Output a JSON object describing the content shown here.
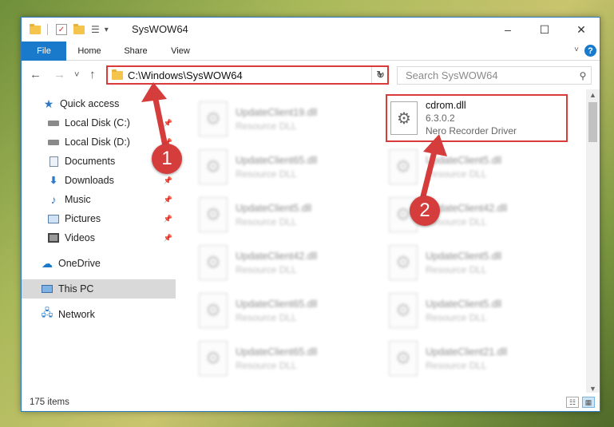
{
  "window": {
    "title": "SysWOW64",
    "controls": {
      "minimize": "–",
      "maximize": "☐",
      "close": "✕"
    }
  },
  "ribbon": {
    "tabs": [
      {
        "label": "File"
      },
      {
        "label": "Home"
      },
      {
        "label": "Share"
      },
      {
        "label": "View"
      }
    ],
    "help": "?"
  },
  "navigation": {
    "back": "←",
    "forward": "→",
    "recent": "˅",
    "up": "↑",
    "address": "C:\\Windows\\SysWOW64",
    "refresh": "↻",
    "search_placeholder": "Search SysWOW64"
  },
  "sidebar": {
    "items": [
      {
        "label": "Quick access",
        "icon": "star-icon",
        "pinned": false
      },
      {
        "label": "Local Disk (C:)",
        "icon": "drive-icon",
        "pinned": true
      },
      {
        "label": "Local Disk (D:)",
        "icon": "drive-icon",
        "pinned": true
      },
      {
        "label": "Documents",
        "icon": "documents-icon",
        "pinned": true
      },
      {
        "label": "Downloads",
        "icon": "downloads-icon",
        "pinned": true
      },
      {
        "label": "Music",
        "icon": "music-icon",
        "pinned": true
      },
      {
        "label": "Pictures",
        "icon": "pictures-icon",
        "pinned": true
      },
      {
        "label": "Videos",
        "icon": "videos-icon",
        "pinned": true
      },
      {
        "label": "OneDrive",
        "icon": "cloud-icon",
        "pinned": false
      },
      {
        "label": "This PC",
        "icon": "computer-icon",
        "pinned": false,
        "selected": true
      },
      {
        "label": "Network",
        "icon": "network-icon",
        "pinned": false
      }
    ]
  },
  "files": {
    "highlighted": {
      "name": "cdrom.dll",
      "version": "6.3.0.2",
      "description": "Nero Recorder Driver"
    },
    "left_column": [
      {
        "name": "UpdateClient19.dll",
        "type": "Resource DLL"
      },
      {
        "name": "UpdateClient65.dll",
        "type": "Resource DLL"
      },
      {
        "name": "UpdateClient5.dll",
        "type": "Resource DLL"
      },
      {
        "name": "UpdateClient42.dll",
        "type": "Resource DLL"
      },
      {
        "name": "UpdateClient65.dll",
        "type": "Resource DLL"
      },
      {
        "name": "UpdateClient65.dll",
        "type": "Resource DLL"
      }
    ],
    "right_column": [
      {
        "name": "UpdateClient5.dll",
        "type": "Resource DLL"
      },
      {
        "name": "UpdateClient42.dll",
        "type": "Resource DLL"
      },
      {
        "name": "UpdateClient5.dll",
        "type": "Resource DLL"
      },
      {
        "name": "UpdateClient5.dll",
        "type": "Resource DLL"
      },
      {
        "name": "UpdateClient21.dll",
        "type": "Resource DLL"
      }
    ]
  },
  "status": {
    "item_count": "175 items"
  },
  "annotations": [
    {
      "number": "1"
    },
    {
      "number": "2"
    }
  ],
  "colors": {
    "accent": "#1979ca",
    "annotation": "#d53c3c"
  }
}
